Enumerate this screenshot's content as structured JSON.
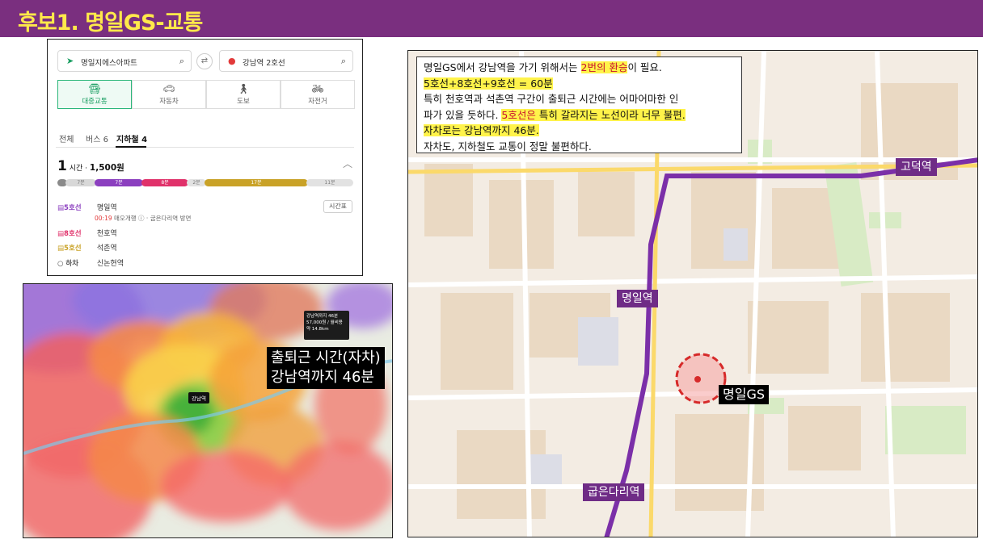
{
  "header": {
    "title": "후보1. 명일GS-교통"
  },
  "directions": {
    "origin": "명일지에스아파트",
    "destination": "강남역 2호선",
    "modes": [
      {
        "icon": "bus-icon",
        "label": "대중교통",
        "active": true
      },
      {
        "icon": "car-icon",
        "label": "자동차",
        "active": false
      },
      {
        "icon": "walk-icon",
        "label": "도보",
        "active": false
      },
      {
        "icon": "bike-icon",
        "label": "자전거",
        "active": false
      }
    ],
    "subtabs": [
      "전체",
      "버스 6",
      "지하철 4"
    ],
    "duration_big": "1",
    "duration_unit": "시간",
    "fare": "1,500원",
    "segments": [
      "7분",
      "7분",
      "8분",
      "2분",
      "17분",
      "11분"
    ],
    "routes": [
      {
        "line": "5호선",
        "color": "#8b3fbf",
        "station": "명일역"
      },
      {
        "line": "8호선",
        "color": "#e0316a",
        "station": "천호역"
      },
      {
        "line": "5호선",
        "color": "#c9a227",
        "station": "석촌역"
      },
      {
        "line": "하차",
        "color": "#555555",
        "station": "신논현역"
      }
    ],
    "sub_time": "00:19",
    "sub_text": "매오개행",
    "sub_dir": "굽은다리역 방면",
    "timetable": "시간표"
  },
  "heatmap": {
    "caption_line1": "출퇴근 시간(자차)",
    "caption_line2": "강남역까지 46분",
    "tooltip": [
      "강남역까지 46분",
      "57,000원 / 월비용",
      "약 14.8km"
    ],
    "pin_label": "강남역"
  },
  "map": {
    "notes": {
      "l1a": "명일GS에서 강남역을 가기 위해서는 ",
      "l1b": "2번의 환승",
      "l1c": "이 필요.",
      "l2": "5호선+8호선+9호선 = 60분",
      "l3": "특히 천호역과 석촌역 구간이 출퇴근 시간에는 어마어마한 인",
      "l4a": "파가 있을 듯하다. ",
      "l4b": "5호선은",
      "l4c": " 특히 갈라지는 노선이라 너무 불편.",
      "l5": "자차로는 강남역까지 46분.",
      "l6": "자차도, 지하철도 교통이 정말 불편하다."
    },
    "stations": {
      "godeok": "고덕역",
      "myeongil": "명일역",
      "gubeun": "굽은다리역"
    },
    "target": "명일GS",
    "line_color": "#7b2fa8"
  }
}
